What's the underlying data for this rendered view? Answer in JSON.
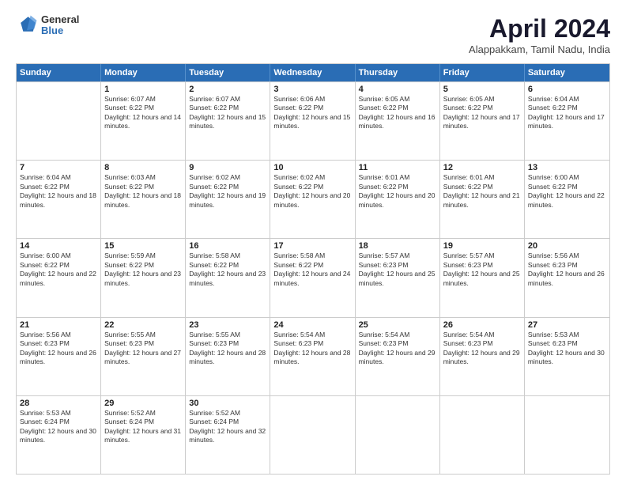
{
  "logo": {
    "general": "General",
    "blue": "Blue"
  },
  "header": {
    "month": "April 2024",
    "location": "Alappakkam, Tamil Nadu, India"
  },
  "weekdays": [
    "Sunday",
    "Monday",
    "Tuesday",
    "Wednesday",
    "Thursday",
    "Friday",
    "Saturday"
  ],
  "rows": [
    [
      {
        "day": "",
        "sunrise": "",
        "sunset": "",
        "daylight": ""
      },
      {
        "day": "1",
        "sunrise": "Sunrise: 6:07 AM",
        "sunset": "Sunset: 6:22 PM",
        "daylight": "Daylight: 12 hours and 14 minutes."
      },
      {
        "day": "2",
        "sunrise": "Sunrise: 6:07 AM",
        "sunset": "Sunset: 6:22 PM",
        "daylight": "Daylight: 12 hours and 15 minutes."
      },
      {
        "day": "3",
        "sunrise": "Sunrise: 6:06 AM",
        "sunset": "Sunset: 6:22 PM",
        "daylight": "Daylight: 12 hours and 15 minutes."
      },
      {
        "day": "4",
        "sunrise": "Sunrise: 6:05 AM",
        "sunset": "Sunset: 6:22 PM",
        "daylight": "Daylight: 12 hours and 16 minutes."
      },
      {
        "day": "5",
        "sunrise": "Sunrise: 6:05 AM",
        "sunset": "Sunset: 6:22 PM",
        "daylight": "Daylight: 12 hours and 17 minutes."
      },
      {
        "day": "6",
        "sunrise": "Sunrise: 6:04 AM",
        "sunset": "Sunset: 6:22 PM",
        "daylight": "Daylight: 12 hours and 17 minutes."
      }
    ],
    [
      {
        "day": "7",
        "sunrise": "Sunrise: 6:04 AM",
        "sunset": "Sunset: 6:22 PM",
        "daylight": "Daylight: 12 hours and 18 minutes."
      },
      {
        "day": "8",
        "sunrise": "Sunrise: 6:03 AM",
        "sunset": "Sunset: 6:22 PM",
        "daylight": "Daylight: 12 hours and 18 minutes."
      },
      {
        "day": "9",
        "sunrise": "Sunrise: 6:02 AM",
        "sunset": "Sunset: 6:22 PM",
        "daylight": "Daylight: 12 hours and 19 minutes."
      },
      {
        "day": "10",
        "sunrise": "Sunrise: 6:02 AM",
        "sunset": "Sunset: 6:22 PM",
        "daylight": "Daylight: 12 hours and 20 minutes."
      },
      {
        "day": "11",
        "sunrise": "Sunrise: 6:01 AM",
        "sunset": "Sunset: 6:22 PM",
        "daylight": "Daylight: 12 hours and 20 minutes."
      },
      {
        "day": "12",
        "sunrise": "Sunrise: 6:01 AM",
        "sunset": "Sunset: 6:22 PM",
        "daylight": "Daylight: 12 hours and 21 minutes."
      },
      {
        "day": "13",
        "sunrise": "Sunrise: 6:00 AM",
        "sunset": "Sunset: 6:22 PM",
        "daylight": "Daylight: 12 hours and 22 minutes."
      }
    ],
    [
      {
        "day": "14",
        "sunrise": "Sunrise: 6:00 AM",
        "sunset": "Sunset: 6:22 PM",
        "daylight": "Daylight: 12 hours and 22 minutes."
      },
      {
        "day": "15",
        "sunrise": "Sunrise: 5:59 AM",
        "sunset": "Sunset: 6:22 PM",
        "daylight": "Daylight: 12 hours and 23 minutes."
      },
      {
        "day": "16",
        "sunrise": "Sunrise: 5:58 AM",
        "sunset": "Sunset: 6:22 PM",
        "daylight": "Daylight: 12 hours and 23 minutes."
      },
      {
        "day": "17",
        "sunrise": "Sunrise: 5:58 AM",
        "sunset": "Sunset: 6:22 PM",
        "daylight": "Daylight: 12 hours and 24 minutes."
      },
      {
        "day": "18",
        "sunrise": "Sunrise: 5:57 AM",
        "sunset": "Sunset: 6:23 PM",
        "daylight": "Daylight: 12 hours and 25 minutes."
      },
      {
        "day": "19",
        "sunrise": "Sunrise: 5:57 AM",
        "sunset": "Sunset: 6:23 PM",
        "daylight": "Daylight: 12 hours and 25 minutes."
      },
      {
        "day": "20",
        "sunrise": "Sunrise: 5:56 AM",
        "sunset": "Sunset: 6:23 PM",
        "daylight": "Daylight: 12 hours and 26 minutes."
      }
    ],
    [
      {
        "day": "21",
        "sunrise": "Sunrise: 5:56 AM",
        "sunset": "Sunset: 6:23 PM",
        "daylight": "Daylight: 12 hours and 26 minutes."
      },
      {
        "day": "22",
        "sunrise": "Sunrise: 5:55 AM",
        "sunset": "Sunset: 6:23 PM",
        "daylight": "Daylight: 12 hours and 27 minutes."
      },
      {
        "day": "23",
        "sunrise": "Sunrise: 5:55 AM",
        "sunset": "Sunset: 6:23 PM",
        "daylight": "Daylight: 12 hours and 28 minutes."
      },
      {
        "day": "24",
        "sunrise": "Sunrise: 5:54 AM",
        "sunset": "Sunset: 6:23 PM",
        "daylight": "Daylight: 12 hours and 28 minutes."
      },
      {
        "day": "25",
        "sunrise": "Sunrise: 5:54 AM",
        "sunset": "Sunset: 6:23 PM",
        "daylight": "Daylight: 12 hours and 29 minutes."
      },
      {
        "day": "26",
        "sunrise": "Sunrise: 5:54 AM",
        "sunset": "Sunset: 6:23 PM",
        "daylight": "Daylight: 12 hours and 29 minutes."
      },
      {
        "day": "27",
        "sunrise": "Sunrise: 5:53 AM",
        "sunset": "Sunset: 6:23 PM",
        "daylight": "Daylight: 12 hours and 30 minutes."
      }
    ],
    [
      {
        "day": "28",
        "sunrise": "Sunrise: 5:53 AM",
        "sunset": "Sunset: 6:24 PM",
        "daylight": "Daylight: 12 hours and 30 minutes."
      },
      {
        "day": "29",
        "sunrise": "Sunrise: 5:52 AM",
        "sunset": "Sunset: 6:24 PM",
        "daylight": "Daylight: 12 hours and 31 minutes."
      },
      {
        "day": "30",
        "sunrise": "Sunrise: 5:52 AM",
        "sunset": "Sunset: 6:24 PM",
        "daylight": "Daylight: 12 hours and 32 minutes."
      },
      {
        "day": "",
        "sunrise": "",
        "sunset": "",
        "daylight": ""
      },
      {
        "day": "",
        "sunrise": "",
        "sunset": "",
        "daylight": ""
      },
      {
        "day": "",
        "sunrise": "",
        "sunset": "",
        "daylight": ""
      },
      {
        "day": "",
        "sunrise": "",
        "sunset": "",
        "daylight": ""
      }
    ]
  ]
}
